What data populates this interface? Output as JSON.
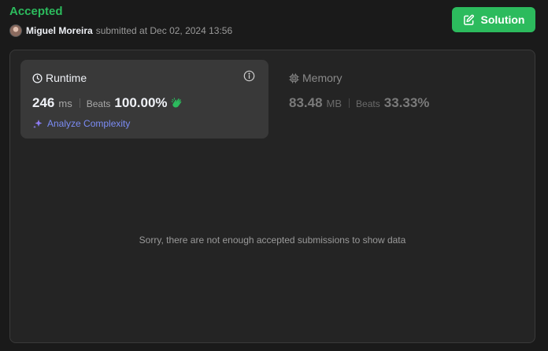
{
  "submission": {
    "status": "Accepted",
    "user_name": "Miguel Moreira",
    "submitted_text": "submitted at Dec 02, 2024 13:56"
  },
  "solution_button": {
    "label": "Solution",
    "icon": "edit-icon",
    "color": "#2cbb5d"
  },
  "runtime": {
    "title": "Runtime",
    "icon": "clock-icon",
    "value": "246",
    "unit": "ms",
    "beats_label": "Beats",
    "beats_value": "100.00%",
    "analyze_label": "Analyze Complexity"
  },
  "memory": {
    "title": "Memory",
    "icon": "chip-icon",
    "value": "83.48",
    "unit": "MB",
    "beats_label": "Beats",
    "beats_value": "33.33%"
  },
  "distribution": {
    "empty_message": "Sorry, there are not enough accepted submissions to show data"
  },
  "colors": {
    "accent_green": "#2cbb5d",
    "link_purple": "#7b8cf5",
    "background": "#1a1a1a",
    "panel": "#242424",
    "card": "#393939"
  }
}
